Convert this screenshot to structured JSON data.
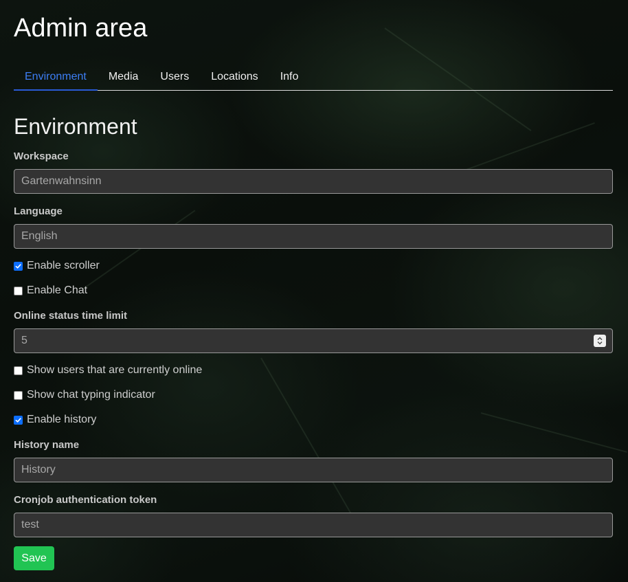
{
  "page": {
    "title": "Admin area"
  },
  "tabs": [
    {
      "label": "Environment",
      "active": true
    },
    {
      "label": "Media",
      "active": false
    },
    {
      "label": "Users",
      "active": false
    },
    {
      "label": "Locations",
      "active": false
    },
    {
      "label": "Info",
      "active": false
    }
  ],
  "section": {
    "title": "Environment"
  },
  "form": {
    "workspace": {
      "label": "Workspace",
      "value": "Gartenwahnsinn"
    },
    "language": {
      "label": "Language",
      "value": "English"
    },
    "enable_scroller": {
      "label": "Enable scroller",
      "checked": true
    },
    "enable_chat": {
      "label": "Enable Chat",
      "checked": false
    },
    "online_status_time_limit": {
      "label": "Online status time limit",
      "value": "5"
    },
    "show_online_users": {
      "label": "Show users that are currently online",
      "checked": false
    },
    "show_typing_indicator": {
      "label": "Show chat typing indicator",
      "checked": false
    },
    "enable_history": {
      "label": "Enable history",
      "checked": true
    },
    "history_name": {
      "label": "History name",
      "value": "History"
    },
    "cronjob_token": {
      "label": "Cronjob authentication token",
      "value": "test"
    },
    "save_label": "Save"
  },
  "colors": {
    "accent_tab": "#3d7ef5",
    "checkbox_on": "#0d6efd",
    "save_button": "#21c453",
    "input_bg": "#333333"
  },
  "icons": {
    "checkmark": "checkmark-icon",
    "stepper": "stepper-arrows-icon"
  }
}
